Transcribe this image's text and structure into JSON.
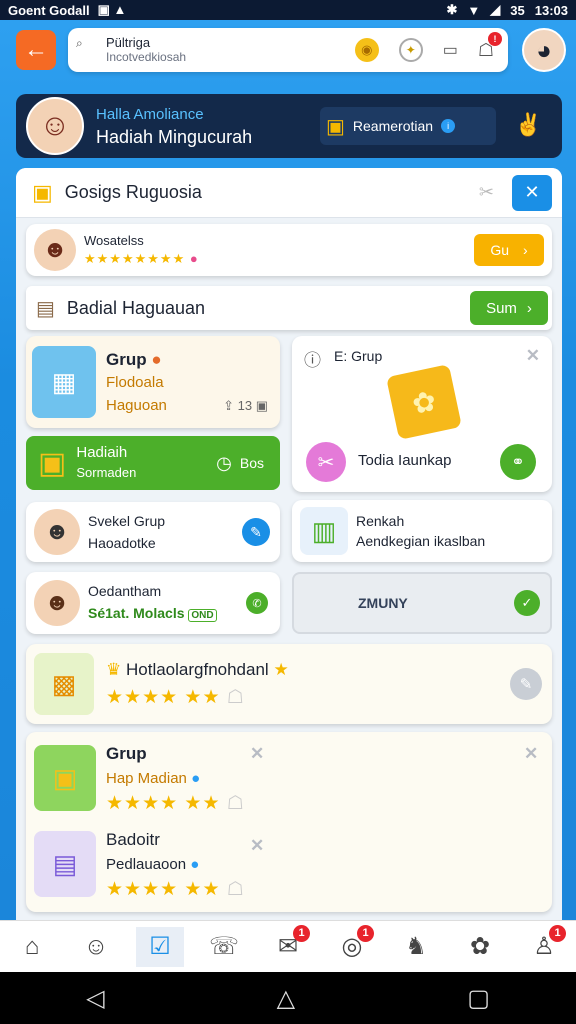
{
  "status": {
    "left": "Goent Godall",
    "right": "13:03",
    "battery": "35"
  },
  "header": {
    "search_title": "Pültriga",
    "search_sub": "Incotvedkiosah"
  },
  "profile": {
    "name_top": "Halla Amoliance",
    "name_main": "Hadiah Mingucurah",
    "reward_label": "Reamerotian"
  },
  "section1": {
    "title": "Gosigs Ruguosia"
  },
  "rating_row": {
    "label": "Wosatelss",
    "button": "Gu"
  },
  "section2": {
    "title": "Badial Haguauan",
    "button": "Sum"
  },
  "grid": {
    "grup_card": {
      "title": "Grup",
      "line1": "Flodoala",
      "line2": "Haguoan",
      "meta": "13"
    },
    "green_card": {
      "title": "Hadiaih",
      "sub": "Sormaden",
      "meta": "Bos"
    },
    "e_grup": {
      "title": "E: Grup",
      "footer": "Todia Iaunkap"
    },
    "user1": {
      "title": "Svekel Grup",
      "sub": "Haoadotke"
    },
    "renkah": {
      "title": "Renkah",
      "sub": "Aendkegian ikaslban"
    },
    "user2": {
      "title": "Oedantham",
      "sub": "Sé1at. Molacls",
      "tag": "OND"
    },
    "zmuny": {
      "label": "ZMUNY"
    }
  },
  "wide_card": {
    "title": "Hotlaolargfnohdanl"
  },
  "list": [
    {
      "title": "Grup",
      "sub": "Hap Madian"
    },
    {
      "title": "Badoitr",
      "sub": "Pedlauaoon"
    }
  ],
  "bottom_nav": [
    {
      "icon": "home-icon",
      "badge": ""
    },
    {
      "icon": "users-icon",
      "badge": ""
    },
    {
      "icon": "check-icon",
      "badge": ""
    },
    {
      "icon": "chat-icon",
      "badge": ""
    },
    {
      "icon": "gift-icon",
      "badge": "1"
    },
    {
      "icon": "coin-icon",
      "badge": "1"
    },
    {
      "icon": "group-icon",
      "badge": ""
    },
    {
      "icon": "settings-icon",
      "badge": ""
    },
    {
      "icon": "profile-icon",
      "badge": "1"
    }
  ],
  "colors": {
    "accent_blue": "#1a8fe6",
    "green": "#4caf2a",
    "orange": "#f56a24",
    "gold": "#f5b800"
  }
}
